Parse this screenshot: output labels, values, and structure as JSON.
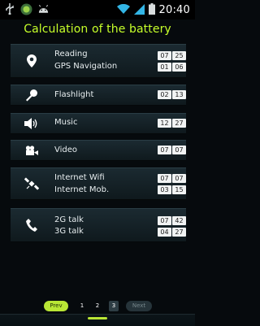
{
  "status_bar": {
    "time": "20:40",
    "left_icons": [
      "usb-icon",
      "app-icon",
      "android-icon"
    ],
    "right_icons": [
      "wifi-icon",
      "signal-icon",
      "battery-icon"
    ]
  },
  "title": "Calculation of the battery",
  "rows": [
    {
      "icon": "location-pin-icon",
      "lines": [
        {
          "label": "Reading",
          "hours": "07",
          "minutes": "25"
        },
        {
          "label": "GPS Navigation",
          "hours": "01",
          "minutes": "06"
        }
      ]
    },
    {
      "icon": "flashlight-icon",
      "lines": [
        {
          "label": "Flashlight",
          "hours": "02",
          "minutes": "13"
        }
      ]
    },
    {
      "icon": "speaker-icon",
      "lines": [
        {
          "label": "Music",
          "hours": "12",
          "minutes": "27"
        }
      ]
    },
    {
      "icon": "video-camera-icon",
      "lines": [
        {
          "label": "Video",
          "hours": "07",
          "minutes": "07"
        }
      ]
    },
    {
      "icon": "satellite-icon",
      "lines": [
        {
          "label": "Internet Wifi",
          "hours": "07",
          "minutes": "07"
        },
        {
          "label": "Internet Mob.",
          "hours": "03",
          "minutes": "15"
        }
      ]
    },
    {
      "icon": "phone-icon",
      "lines": [
        {
          "label": "2G talk",
          "hours": "07",
          "minutes": "42"
        },
        {
          "label": "3G talk",
          "hours": "04",
          "minutes": "27"
        }
      ]
    }
  ],
  "pager": {
    "prev_label": "Prev",
    "pages": [
      "1",
      "2",
      "3"
    ],
    "active_page": "3",
    "next_label": "Next"
  },
  "colors": {
    "accent": "#c6ff2a",
    "background": "#060a0d",
    "row_bg": "#1b2a31",
    "value_box": "#f1f3f3"
  }
}
